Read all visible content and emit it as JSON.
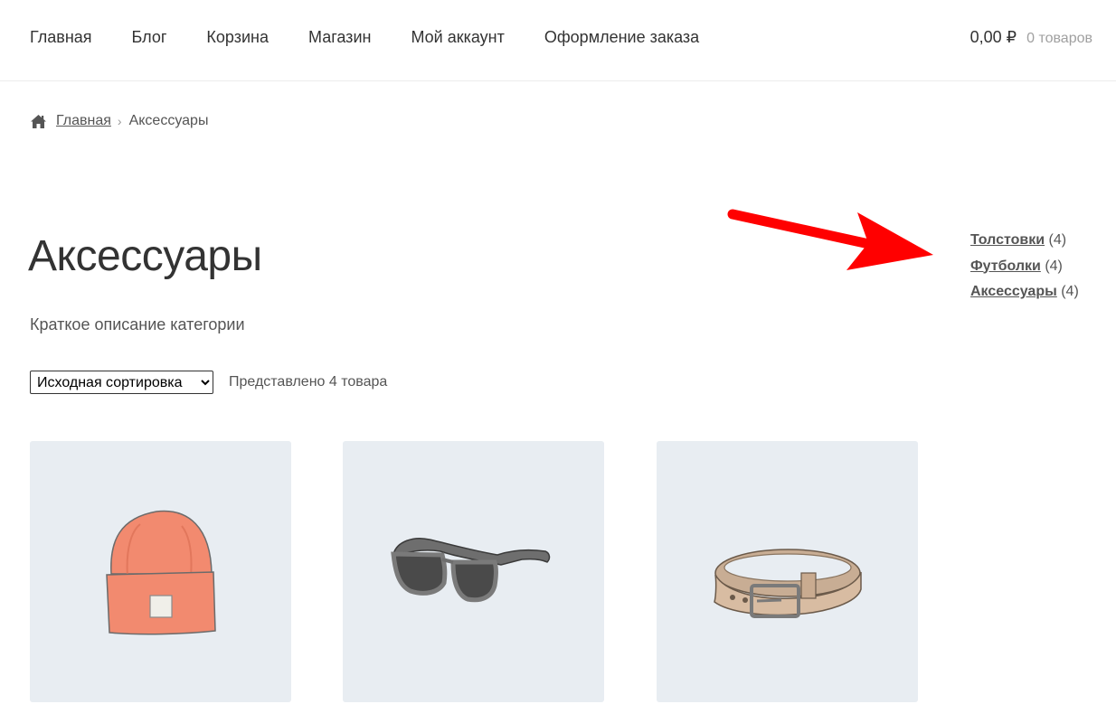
{
  "nav": {
    "items": [
      "Главная",
      "Блог",
      "Корзина",
      "Магазин",
      "Мой аккаунт",
      "Оформление заказа"
    ]
  },
  "cart": {
    "amount": "0,00 ₽",
    "count": "0 товаров"
  },
  "breadcrumb": {
    "home": "Главная",
    "separator": "›",
    "current": "Аксессуары"
  },
  "page": {
    "title": "Аксессуары",
    "description": "Краткое описание категории"
  },
  "sort": {
    "selected": "Исходная сортировка",
    "result_count": "Представлено 4 товара"
  },
  "categories_widget": {
    "items": [
      {
        "label": "Толстовки",
        "count": "(4)"
      },
      {
        "label": "Футболки",
        "count": "(4)"
      },
      {
        "label": "Аксессуары",
        "count": "(4)"
      }
    ]
  },
  "products": [
    {
      "image": "orange-beanie"
    },
    {
      "image": "sunglasses"
    },
    {
      "image": "leather-belt"
    }
  ],
  "colors": {
    "arrow": "#ff0000",
    "product_bg": "#e8edf2",
    "beanie": "#f28a6f"
  }
}
